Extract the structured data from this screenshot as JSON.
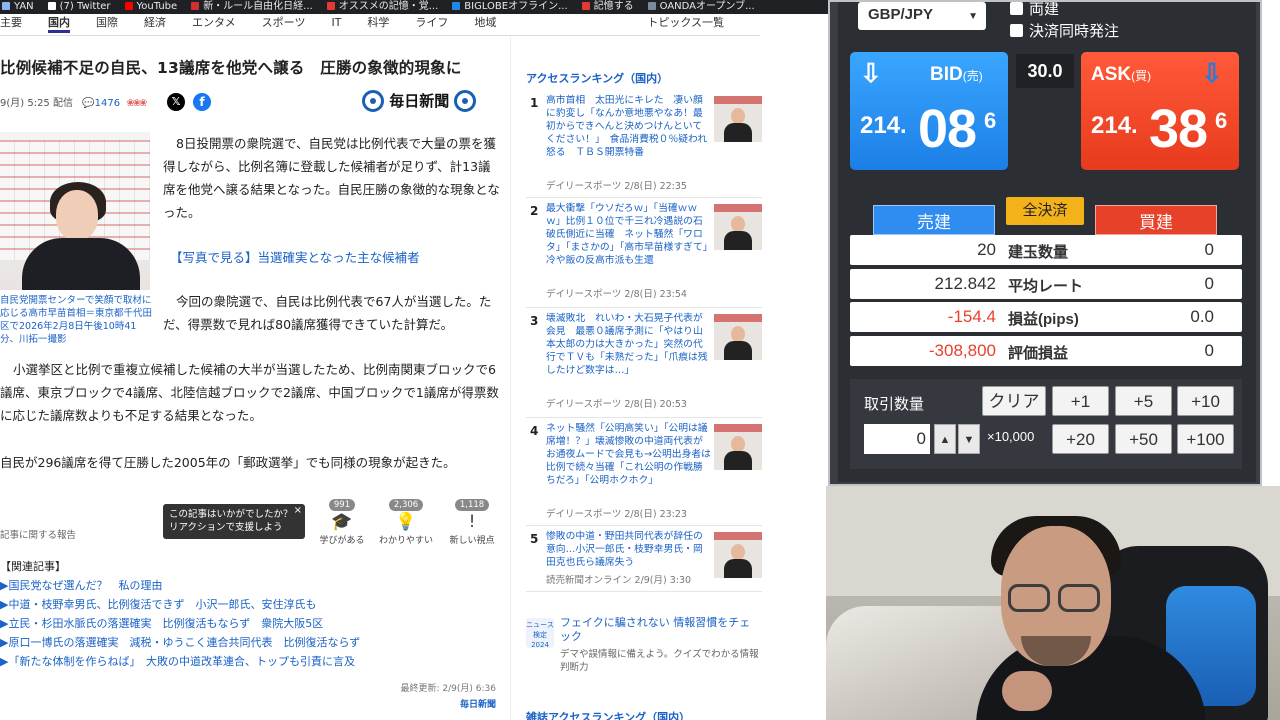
{
  "bookmarks": [
    {
      "label": "YAN",
      "color": "#8ab4f8"
    },
    {
      "label": "(7) Twitter",
      "color": "#ffffff"
    },
    {
      "label": "YouTube",
      "color": "#ff0000"
    },
    {
      "label": "新・ルール自由化日経...",
      "color": "#d32f2f"
    },
    {
      "label": "オススメの記憶・覚...",
      "color": "#e53935"
    },
    {
      "label": "BIGLOBEオフライン...",
      "color": "#1e88e5"
    },
    {
      "label": "記憶する",
      "color": "#e53935"
    },
    {
      "label": "OANDAオープンブ...",
      "color": "#7c8b99"
    }
  ],
  "nav": {
    "items": [
      "主要",
      "国内",
      "国際",
      "経済",
      "エンタメ",
      "スポーツ",
      "IT",
      "科学",
      "ライフ",
      "地域"
    ],
    "active_index": 1,
    "right": "トピックス一覧"
  },
  "article": {
    "headline": "比例候補不足の自民、13議席を他党へ譲る　圧勝の象徴的現象に",
    "meta_date": "9(月) 5:25 配信",
    "comment_count": "1476",
    "x_label": "𝕏",
    "fb_label": "f",
    "publisher": "毎日新聞",
    "caption": "自民党開票センターで笑顔で取材に応じる高市早苗首相＝東京都千代田区で2026年2月8日午後10時41分、川拓一撮影",
    "p1": "8日投開票の衆院選で、自民党は比例代表で大量の票を獲得しながら、比例名簿に登載した候補者が足りず、計13議席を他党へ譲る結果となった。自民圧勝の象徴的な現象となった。",
    "p2": "【写真で見る】当選確実となった主な候補者",
    "p3": "今回の衆院選で、自民は比例代表で67人が当選した。ただ、得票数で見れば80議席獲得できていた計算だ。",
    "p4": "小選挙区と比例で重複立候補した候補の大半が当選したため、比例南関東ブロックで6議席、東京ブロックで4議席、北陸信越ブロックで2議席、中国ブロックで1議席が得票数に応じた議席数よりも不足する結果となった。",
    "p5": "自民が296議席を得て圧勝した2005年の「郵政選挙」でも同様の現象が起きた。",
    "report": "記事に関する報告",
    "tooltip": "この記事はいかがでしたか？リアクションで支援しよう",
    "tooltip_close": "×",
    "reactions": [
      {
        "label": "学びがある",
        "count": "991",
        "icon": "🎓"
      },
      {
        "label": "わかりやすい",
        "count": "2,306",
        "icon": "💡"
      },
      {
        "label": "新しい視点",
        "count": "1,118",
        "icon": "!"
      }
    ],
    "related_title": "【関連記事】",
    "related": [
      "▶国民党なぜ選んだ？　私の理由",
      "▶中道・枝野幸男氏、比例復活できず　小沢一郎氏、安住淳氏も",
      "▶立民・杉田水脈氏の落選確実　比例復活もならず　衆院大阪5区",
      "▶原口一博氏の落選確実　減税・ゆうこく連合共同代表　比例復活ならず",
      "▶「新たな体制を作らねば」　大敗の中道改革連合、トップも引責に言及"
    ],
    "updated": "最終更新: 2/9(月) 6:36",
    "updated_src": "毎日新聞"
  },
  "ranking": {
    "title": "アクセスランキング（国内）",
    "items": [
      {
        "num": "1",
        "text": "高市首相　太田光にキレた　凄い顔に豹変し「なんか意地悪やなあ！最初からできへんと決めつけんといてください！」　食品消費税０％疑われ怒る　ＴＢＳ開票特番",
        "source": "デイリースポーツ 2/8(日) 22:35"
      },
      {
        "num": "2",
        "text": "最大衝撃「ウソだろｗ」「当確ｗｗｗ」比例１０位で千三れ冷遇説の石破氏側近に当確　ネット騒然「ワロタ」「まさかの」「高市早苗様すぎて」冷や飯の反高市派も生還",
        "source": "デイリースポーツ 2/8(日) 23:54"
      },
      {
        "num": "3",
        "text": "壊滅敗北　れいわ・大石晃子代表が会見　最悪０議席予測に「やはり山本太郎の力は大きかった」突然の代行でＴＶも「未熟だった」「爪痕は残したけど数字は…」",
        "source": "デイリースポーツ 2/8(日) 20:53"
      },
      {
        "num": "4",
        "text": "ネット騒然「公明高笑い」「公明は議席増！？」壊滅惨敗の中道両代表がお通夜ムードで会見も→公明出身者は比例で続々当確「これ公明の作戦勝ちだろ」「公明ホクホク」",
        "source": "デイリースポーツ 2/8(日) 23:23"
      },
      {
        "num": "5",
        "text": "惨敗の中道・野田共同代表が辞任の意向…小沢一郎氏・枝野幸男氏・岡田克也氏ら議席失う",
        "source": "読売新聞オンライン 2/9(月) 3:30"
      }
    ],
    "news_badge": "ニュース検定 2024",
    "news_headline": "フェイクに騙されない 情報習慣をチェック",
    "news_desc": "デマや誤情報に備えよう。クイズでわかる情報判断力",
    "title2": "雑誌アクセスランキング（国内）"
  },
  "trade": {
    "pair": "GBP/JPY",
    "chk_ryodate": "両建",
    "chk_kessai": "決済同時発注",
    "bid_label": "BID",
    "bid_sub": "(売)",
    "bid_small": "214.",
    "bid_big": "08",
    "bid_pip": "6",
    "ask_label": "ASK",
    "ask_sub": "(買)",
    "ask_small": "214.",
    "ask_big": "38",
    "ask_pip": "6",
    "spread": "30.0",
    "tab_sell": "売建",
    "tab_buy": "買建",
    "tab_all": "全決済",
    "rows": [
      {
        "v1": "20",
        "label": "建玉数量",
        "v2": "0",
        "neg": false
      },
      {
        "v1": "212.842",
        "label": "平均レート",
        "v2": "0",
        "neg": false
      },
      {
        "v1": "-154.4",
        "label": "損益(pips)",
        "v2": "0.0",
        "neg": true
      },
      {
        "v1": "-308,800",
        "label": "評価損益",
        "v2": "0",
        "neg": true
      }
    ],
    "lot_title": "取引数量",
    "lot_value": "0",
    "unit": "×10,000",
    "btn_clear": "クリア",
    "btn_p1": "+1",
    "btn_p5": "+5",
    "btn_p10": "+10",
    "btn_p20": "+20",
    "btn_p50": "+50",
    "btn_p100": "+100",
    "up_arrow": "▲",
    "down_arrow": "▼",
    "bid_color": "#1c7fe6",
    "ask_color": "#e83a1d"
  }
}
